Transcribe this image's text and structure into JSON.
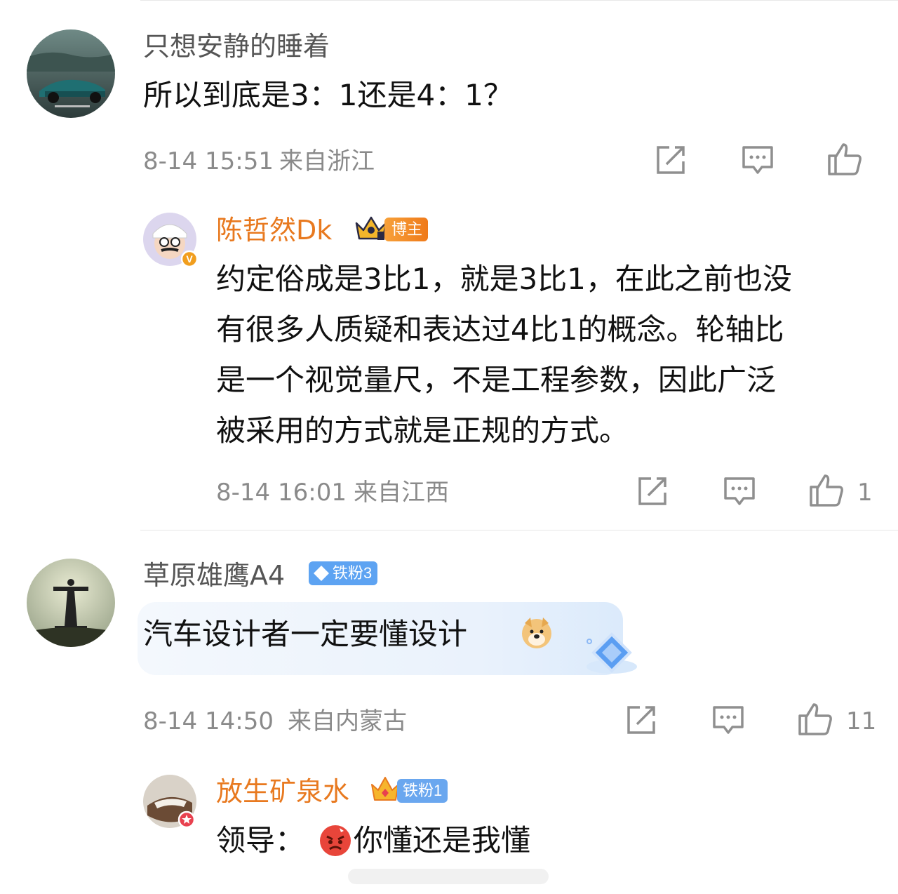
{
  "comments": [
    {
      "username": "只想安静的睡着",
      "text": "所以到底是3：1还是4：1？",
      "time": "8-14 15:51",
      "location": "来自浙江",
      "likes": "",
      "reply": {
        "username": "陈哲然Dk",
        "badge": "博主",
        "text_lines": [
          "约定俗成是3比1，就是3比1，在此之前也没",
          "有很多人质疑和表达过4比1的概念。轮轴比",
          "是一个视觉量尺，不是工程参数，因此广泛",
          "被采用的方式就是正规的方式。"
        ],
        "time": "8-14 16:01",
        "location": "来自江西",
        "likes": "1"
      }
    },
    {
      "username": "草原雄鹰A4",
      "badge": "铁粉3",
      "text": "汽车设计者一定要懂设计",
      "time": "8-14 14:50",
      "location": "来自内蒙古",
      "likes": "11",
      "reply": {
        "username": "放生矿泉水",
        "badge": "铁粉1",
        "text": "领导：",
        "text_after_emoji": "你懂还是我懂"
      }
    }
  ],
  "icons": {
    "share": "share-icon",
    "comment": "comment-icon",
    "like": "thumbs-up-icon"
  },
  "colors": {
    "username_vip": "#e8791f",
    "meta": "#8a8a8a",
    "blogger_badge": "#f08a25",
    "fan_badge": "#5da3f2"
  }
}
